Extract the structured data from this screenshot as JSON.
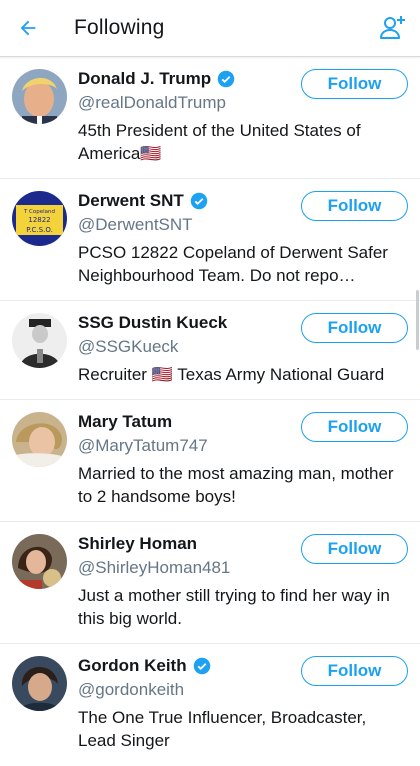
{
  "header": {
    "title": "Following",
    "back_icon": "back-arrow-icon",
    "add_user_icon": "add-user-icon",
    "accent": "#1da1f2"
  },
  "follow_label": "Follow",
  "users": [
    {
      "name": "Donald J. Trump",
      "handle": "@realDonaldTrump",
      "verified": true,
      "bio": "45th President of the United States of America🇺🇸"
    },
    {
      "name": "Derwent SNT",
      "handle": "@DerwentSNT",
      "verified": true,
      "bio": "PCSO 12822 Copeland of Derwent Safer Neighbourhood Team. Do not repo…"
    },
    {
      "name": "SSG Dustin Kueck",
      "handle": "@SSGKueck",
      "verified": false,
      "bio": "Recruiter 🇺🇸 Texas Army National Guard"
    },
    {
      "name": "Mary Tatum",
      "handle": "@MaryTatum747",
      "verified": false,
      "bio": "Married to the most amazing man, mother to 2 handsome boys!"
    },
    {
      "name": "Shirley Homan",
      "handle": "@ShirleyHoman481",
      "verified": false,
      "bio": "Just a mother still trying to find her way in this big world."
    },
    {
      "name": "Gordon Keith",
      "handle": "@gordonkeith",
      "verified": true,
      "bio": "The One True Influencer, Broadcaster, Lead Singer"
    }
  ],
  "avatar_badge": {
    "line1": "T Copeland",
    "line2": "12822",
    "line3": "P.C.S.O."
  }
}
